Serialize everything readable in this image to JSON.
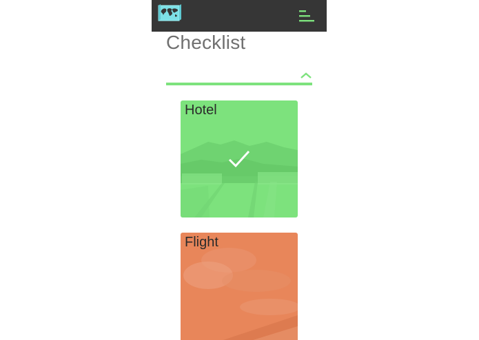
{
  "app": {
    "logo_icon": "world-map-icon",
    "menu_icon": "hamburger-menu-icon",
    "accent": "#7de27d",
    "topbar_color": "#363636"
  },
  "page": {
    "title": "Checklist"
  },
  "section": {
    "toggle_icon": "chevron-up-icon"
  },
  "cards": [
    {
      "label": "Hotel",
      "status": "checked",
      "color": "#7de27d",
      "status_icon": "checkmark-icon"
    },
    {
      "label": "Flight",
      "status": "unchecked",
      "color": "#e8865a"
    }
  ]
}
